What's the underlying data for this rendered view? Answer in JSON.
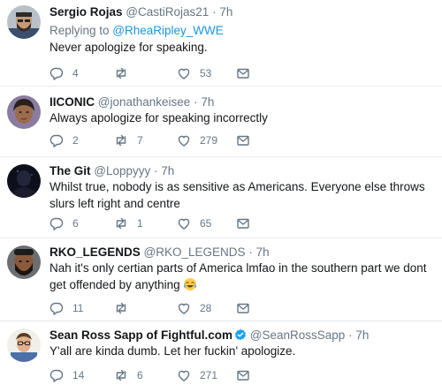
{
  "tweets": [
    {
      "name": "Sergio Rojas",
      "handle": "@CastiRojas21",
      "sep": "·",
      "time": "7h",
      "replying_prefix": "Replying to ",
      "replying_to": "@RheaRipley_WWE",
      "text": "Never apologize for speaking.",
      "replies": "4",
      "retweets": "",
      "likes": "53",
      "avatar_icon": "bearded-man-photo"
    },
    {
      "name": "IICONIC",
      "handle": "@jonathankeisee",
      "sep": "·",
      "time": "7h",
      "text": "Always apologize for speaking incorrectly",
      "replies": "2",
      "retweets": "7",
      "likes": "279",
      "avatar_icon": "woman-photo"
    },
    {
      "name": "The Git",
      "handle": "@Loppyyy",
      "sep": "·",
      "time": "7h",
      "text": "Whilst true, nobody is as sensitive as Americans. Everyone else throws slurs left right and centre",
      "replies": "6",
      "retweets": "1",
      "likes": "65",
      "avatar_icon": "dark-silhouette-photo"
    },
    {
      "name": "RKO_LEGENDS",
      "handle": "@RKO_LEGENDS",
      "sep": "·",
      "time": "7h",
      "text": "Nah it's only certian parts of America lmfao in the southern part we dont get offended by anything",
      "emoji": "face-with-tears-of-joy",
      "replies": "11",
      "retweets": "",
      "likes": "28",
      "avatar_icon": "bearded-man-photo"
    },
    {
      "name": "Sean Ross Sapp of Fightful.com",
      "handle": "@SeanRossSapp",
      "sep": "·",
      "time": "7h",
      "text": "Y'all are kinda dumb. Let her fuckin' apologize.",
      "replies": "14",
      "retweets": "6",
      "likes": "271",
      "verified": true,
      "avatar_icon": "man-with-glasses-photo"
    }
  ],
  "colors": {
    "text": "#14171a",
    "secondary": "#657786",
    "link": "#1b95e0",
    "divider": "#e6ecf0",
    "verified": "#1da1f2"
  }
}
